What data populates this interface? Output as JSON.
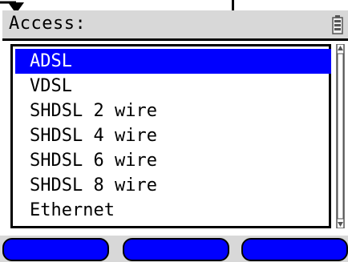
{
  "header": {
    "title": "Access:",
    "battery_icon": "battery-icon"
  },
  "access_list": {
    "items": [
      {
        "label": "ADSL",
        "selected": true
      },
      {
        "label": "VDSL",
        "selected": false
      },
      {
        "label": "SHDSL 2 wire",
        "selected": false
      },
      {
        "label": "SHDSL 4 wire",
        "selected": false
      },
      {
        "label": "SHDSL 6 wire",
        "selected": false
      },
      {
        "label": "SHDSL 8 wire",
        "selected": false
      },
      {
        "label": "Ethernet",
        "selected": false
      }
    ]
  },
  "softkeys": [
    {
      "label": ""
    },
    {
      "label": ""
    },
    {
      "label": ""
    }
  ],
  "colors": {
    "selection": "#0000ff",
    "header_bg": "#d8d8d8",
    "softkey": "#0000ff"
  }
}
